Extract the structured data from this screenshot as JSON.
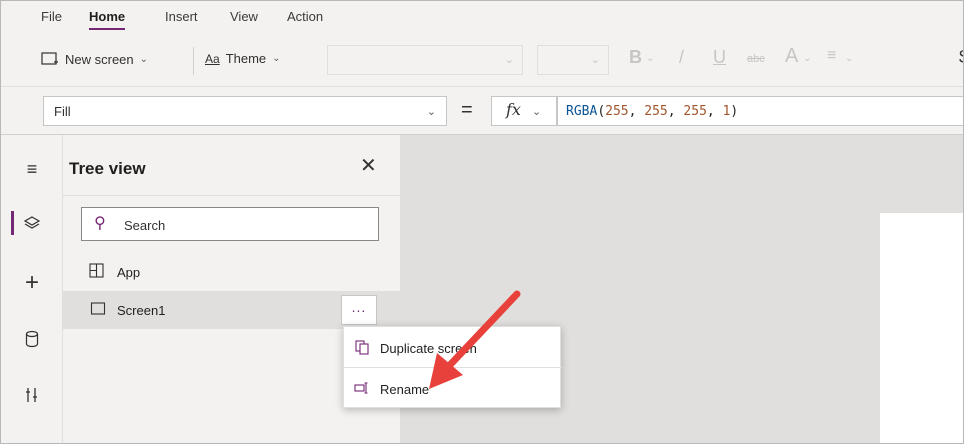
{
  "menu": {
    "tabs": [
      "File",
      "Home",
      "Insert",
      "View",
      "Action"
    ],
    "active": "Home"
  },
  "ribbon": {
    "new_screen_label": "New screen",
    "theme_label": "Theme"
  },
  "formula_bar": {
    "property": "Fill",
    "equals": "=",
    "fx": "fx",
    "formula": {
      "fn": "RGBA",
      "r": "255",
      "g": "255",
      "b": "255",
      "a": "1"
    }
  },
  "tree_view": {
    "title": "Tree view",
    "search_placeholder": "Search",
    "nodes": [
      {
        "label": "App",
        "icon": "app-icon"
      },
      {
        "label": "Screen1",
        "icon": "screen-icon",
        "selected": true
      }
    ],
    "more_label": "..."
  },
  "context_menu": {
    "items": [
      {
        "label": "Duplicate screen",
        "icon": "duplicate-icon"
      },
      {
        "label": "Rename",
        "icon": "rename-icon"
      }
    ]
  },
  "colors": {
    "accent": "#742774",
    "annotation_arrow": "#e8403a"
  }
}
